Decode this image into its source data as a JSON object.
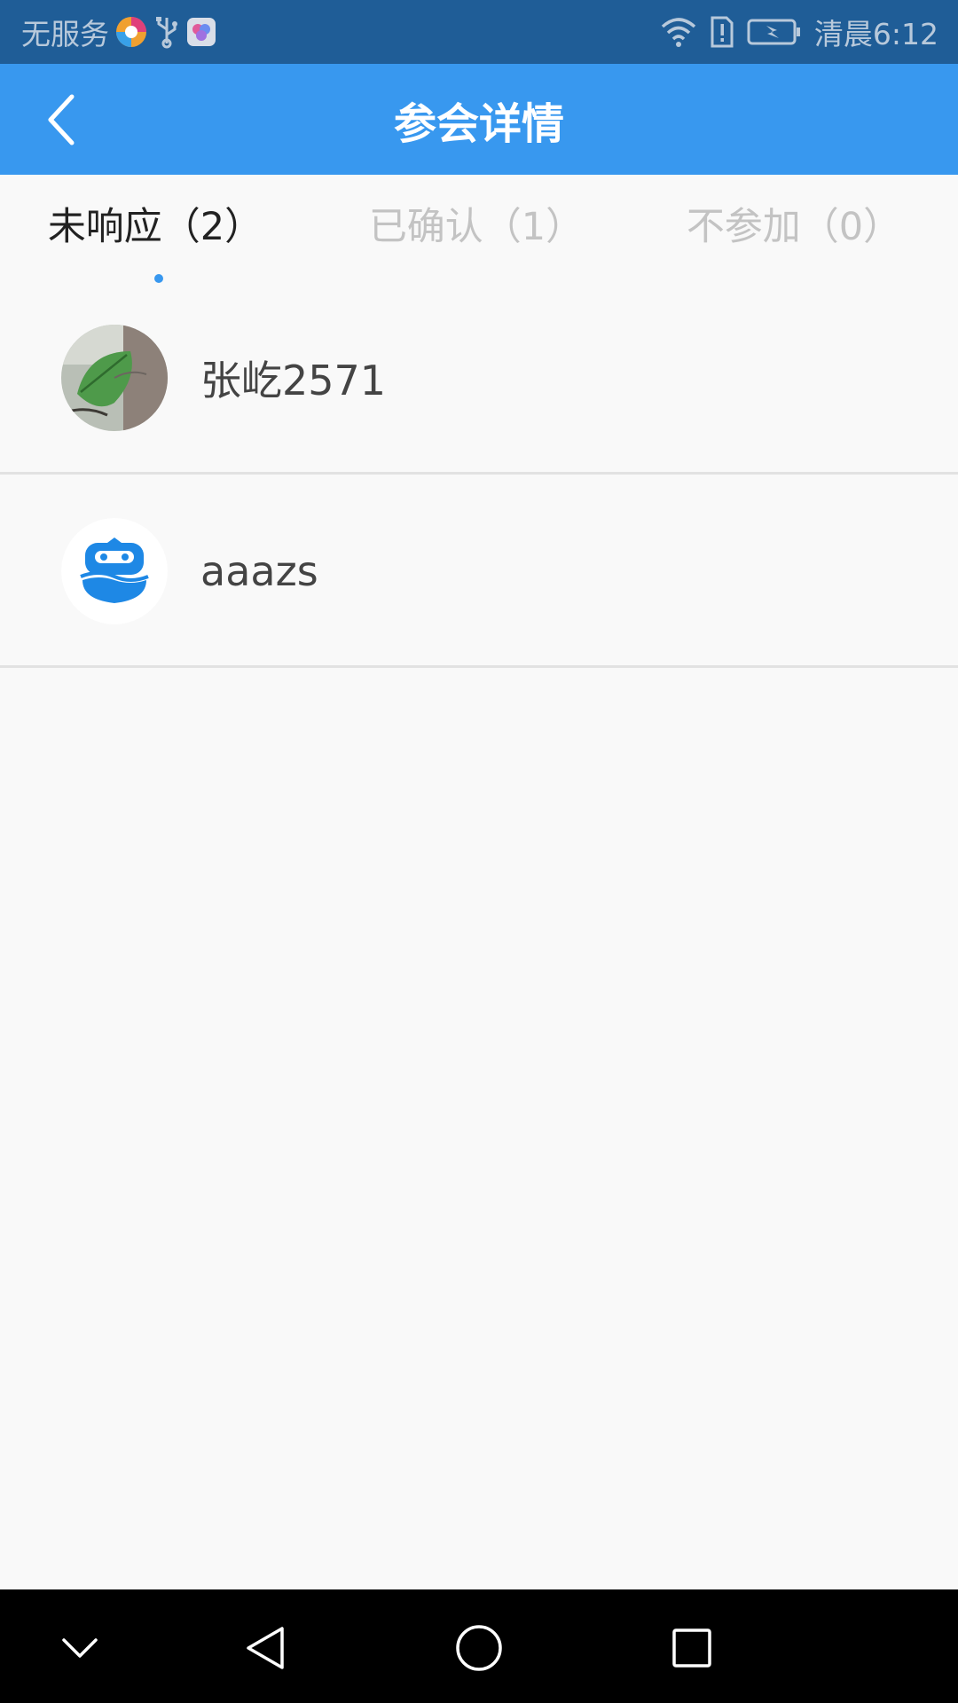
{
  "status_bar": {
    "carrier": "无服务",
    "time": "清晨6:12",
    "icons": [
      "browser-app-icon",
      "usb-icon",
      "app-notification-icon",
      "wifi-icon",
      "sim-alert-icon",
      "battery-charging-icon"
    ]
  },
  "header": {
    "title": "参会详情",
    "back_icon": "chevron-left-icon"
  },
  "tabs": [
    {
      "label": "未响应（2）",
      "active": true
    },
    {
      "label": "已确认（1）",
      "active": false
    },
    {
      "label": "不参加（0）",
      "active": false
    }
  ],
  "members": [
    {
      "name": "张屹2571",
      "avatar": "photo-avatar"
    },
    {
      "name": "aaazs",
      "avatar": "robot-avatar"
    }
  ],
  "nav_bar": {
    "icons": [
      "collapse-chevron-icon",
      "back-triangle-icon",
      "home-circle-icon",
      "recents-square-icon"
    ]
  },
  "colors": {
    "status_bar": "#1f5d97",
    "app_bar": "#3898ef",
    "background": "#f9f9f9",
    "active_tab_text": "#222222",
    "inactive_tab_text": "#c3c3c3",
    "divider": "#e2e2e2"
  }
}
